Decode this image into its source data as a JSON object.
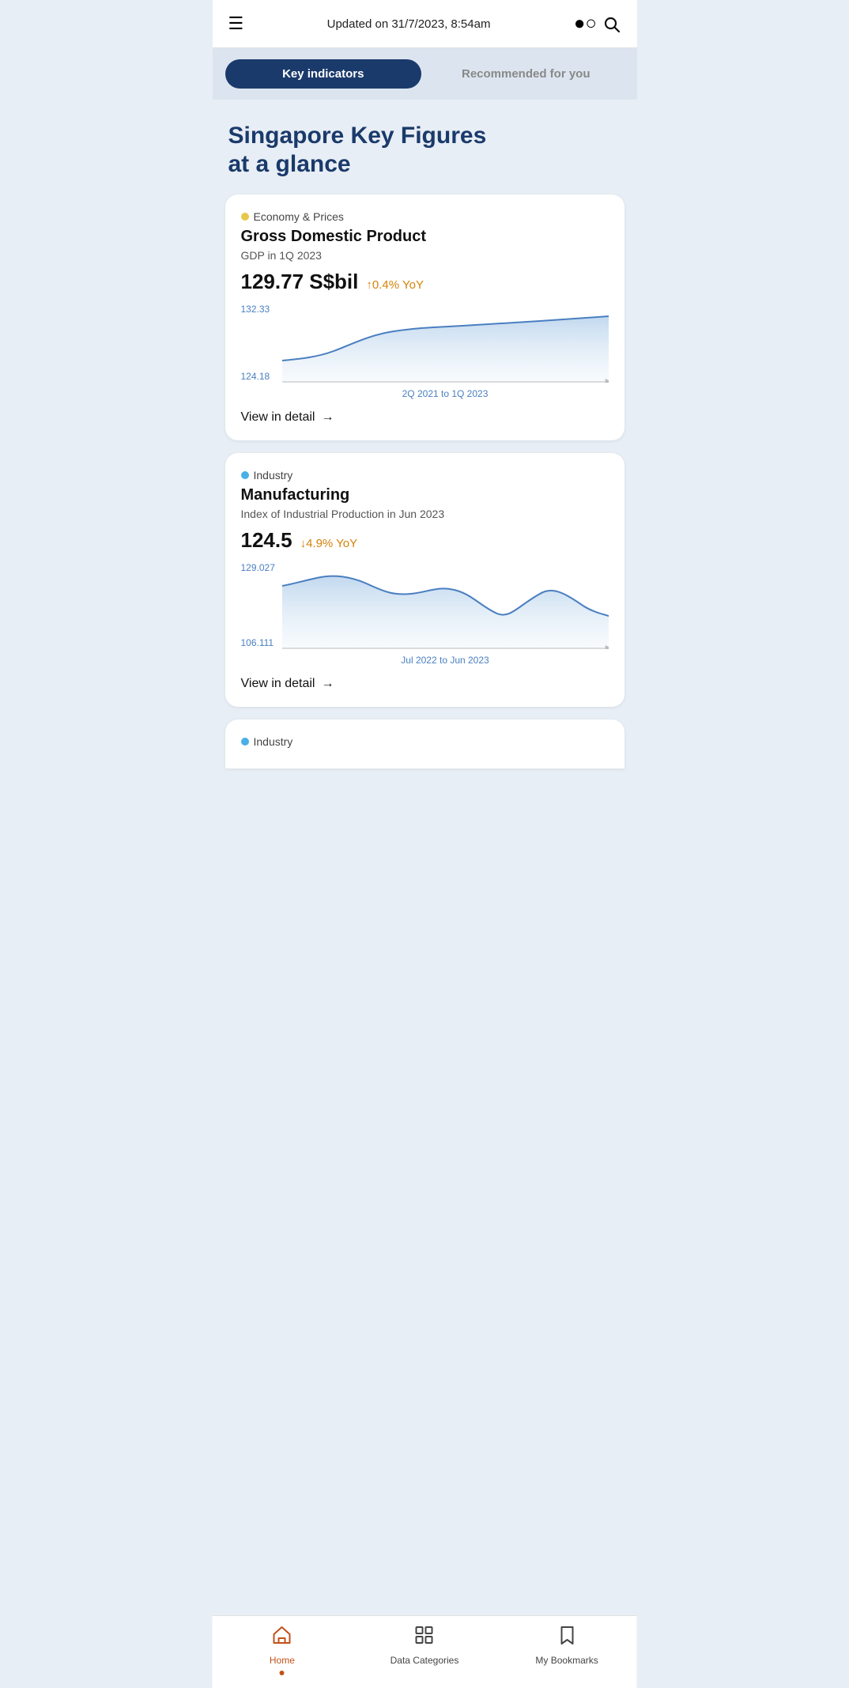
{
  "header": {
    "menu_icon": "☰",
    "title": "Updated on 31/7/2023, 8:54am",
    "search_icon": "⌕"
  },
  "tabs": [
    {
      "id": "key-indicators",
      "label": "Key indicators",
      "active": true
    },
    {
      "id": "recommended",
      "label": "Recommended for you",
      "active": false
    }
  ],
  "page": {
    "title_line1": "Singapore Key Figures",
    "title_line2": "at a glance"
  },
  "cards": [
    {
      "id": "gdp",
      "category_dot": "yellow",
      "category": "Economy & Prices",
      "title": "Gross Domestic Product",
      "subtitle": "GDP in 1Q 2023",
      "value": "129.77 S$bil",
      "change_arrow": "↑",
      "change_value": "0.4% YoY",
      "chart_max": "132.33",
      "chart_min": "124.18",
      "chart_x_label": "2Q 2021 to 1Q 2023",
      "view_detail": "View in detail"
    },
    {
      "id": "manufacturing",
      "category_dot": "blue",
      "category": "Industry",
      "title": "Manufacturing",
      "subtitle": "Index of Industrial Production in Jun 2023",
      "value": "124.5",
      "change_arrow": "↓",
      "change_value": "4.9% YoY",
      "chart_max": "129.027",
      "chart_min": "106.111",
      "chart_x_label": "Jul 2022 to Jun 2023",
      "view_detail": "View in detail"
    }
  ],
  "partial_card": {
    "category_dot": "blue",
    "category": "Industry"
  },
  "nav": [
    {
      "id": "home",
      "icon": "home",
      "label": "Home",
      "active": true
    },
    {
      "id": "data-categories",
      "icon": "grid",
      "label": "Data Categories",
      "active": false
    },
    {
      "id": "my-bookmarks",
      "icon": "bookmark",
      "label": "My Bookmarks",
      "active": false
    }
  ]
}
